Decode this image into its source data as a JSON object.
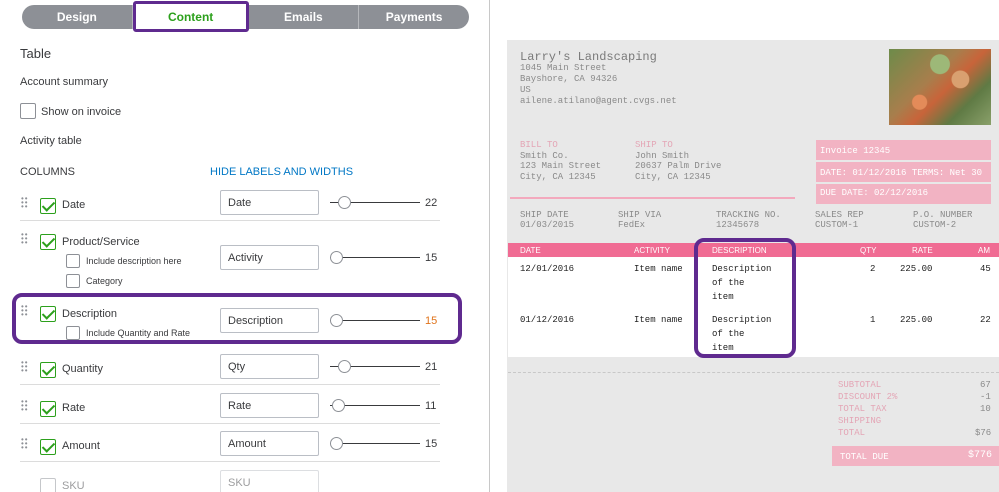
{
  "tabs": [
    {
      "label": "Design",
      "active": false
    },
    {
      "label": "Content",
      "active": true
    },
    {
      "label": "Emails",
      "active": false
    },
    {
      "label": "Payments",
      "active": false
    }
  ],
  "settings": {
    "table_heading": "Table",
    "account_summary": "Account summary",
    "show_on_invoice": "Show on invoice",
    "activity_table": "Activity table",
    "columns_label": "COLUMNS",
    "hide_labels_link": "HIDE LABELS AND WIDTHS",
    "rows": [
      {
        "name": "Date",
        "checked": true,
        "field": "Date",
        "width": "22",
        "slider_pos": 0.11
      },
      {
        "name": "Product/Service",
        "checked": true,
        "field": "Activity",
        "width": "15",
        "slider_pos": 0.0,
        "sub": [
          {
            "label": "Include description here",
            "checked": false
          },
          {
            "label": "Category",
            "checked": false
          }
        ]
      },
      {
        "name": "Description",
        "checked": true,
        "field": "Description",
        "width": "15",
        "slider_pos": 0.0,
        "sub": [
          {
            "label": "Include Quantity and Rate",
            "checked": false
          }
        ]
      },
      {
        "name": "Quantity",
        "checked": true,
        "field": "Qty",
        "width": "21",
        "slider_pos": 0.1
      },
      {
        "name": "Rate",
        "checked": true,
        "field": "Rate",
        "width": "11",
        "slider_pos": 0.03
      },
      {
        "name": "Amount",
        "checked": true,
        "field": "Amount",
        "width": "15",
        "slider_pos": 0.0
      },
      {
        "name": "SKU",
        "checked": false,
        "field": "SKU",
        "width": "",
        "slider_pos": 0.0
      }
    ]
  },
  "invoice": {
    "company_name": "Larry's Landscaping",
    "address1": "1045 Main Street",
    "address2": "Bayshore, CA 94326",
    "country": "US",
    "email": "ailene.atilano@agent.cvgs.net",
    "bill_to_label": "BILL TO",
    "bill_to": [
      "Smith Co.",
      "123 Main Street",
      "City, CA 12345"
    ],
    "ship_to_label": "SHIP TO",
    "ship_to": [
      "John Smith",
      "20637 Palm Drive",
      "City, CA 12345"
    ],
    "invoice_no": "Invoice 12345",
    "date_line": "DATE: 01/12/2016   TERMS: Net 30",
    "due_date": "DUE DATE: 02/12/2016",
    "ship_headers": [
      "SHIP DATE",
      "SHIP VIA",
      "TRACKING NO.",
      "SALES REP",
      "P.O. NUMBER"
    ],
    "ship_values": [
      "01/03/2015",
      "FedEx",
      "12345678",
      "CUSTOM-1",
      "CUSTOM-2"
    ],
    "table_headers": [
      "DATE",
      "ACTIVITY",
      "DESCRIPTION",
      "QTY",
      "RATE",
      "AM"
    ],
    "items": [
      {
        "date": "12/01/2016",
        "activity": "Item name",
        "desc": [
          "Description",
          "of the",
          "item"
        ],
        "qty": "2",
        "rate": "225.00",
        "amount": "45"
      },
      {
        "date": "01/12/2016",
        "activity": "Item name",
        "desc": [
          "Description",
          "of the",
          "item"
        ],
        "qty": "1",
        "rate": "225.00",
        "amount": "22"
      }
    ],
    "totals": [
      {
        "label": "SUBTOTAL",
        "value": "67"
      },
      {
        "label": "DISCOUNT 2%",
        "value": "-1"
      },
      {
        "label": "TOTAL TAX",
        "value": "10"
      },
      {
        "label": "SHIPPING",
        "value": ""
      },
      {
        "label": "TOTAL",
        "value": "$76"
      }
    ],
    "total_due_label": "TOTAL DUE",
    "total_due_value": "$776"
  },
  "colors": {
    "accent_green": "#2ca01c",
    "highlight_purple": "#5f2a8f",
    "invoice_pink": "#f06b93",
    "link_blue": "#0077c5"
  }
}
